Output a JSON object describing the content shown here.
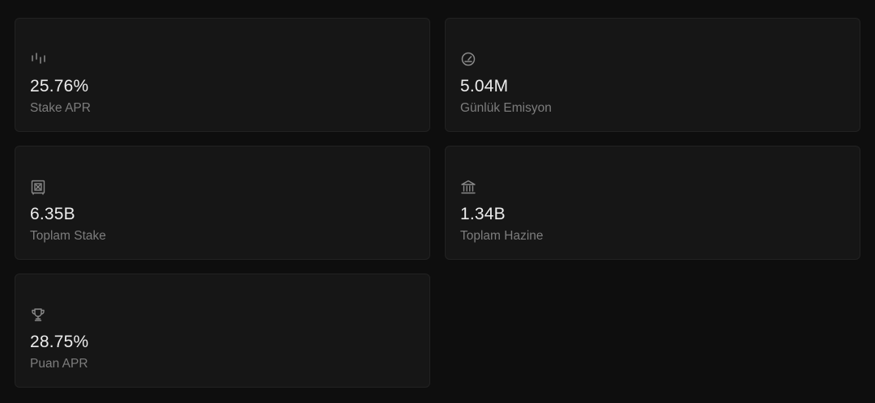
{
  "stats": [
    {
      "value": "25.76%",
      "label": "Stake APR",
      "icon": "bar-chart-icon"
    },
    {
      "value": "5.04M",
      "label": "Günlük Emisyon",
      "icon": "gauge-icon"
    },
    {
      "value": "6.35B",
      "label": "Toplam Stake",
      "icon": "vault-icon"
    },
    {
      "value": "1.34B",
      "label": "Toplam Hazine",
      "icon": "bank-icon"
    },
    {
      "value": "28.75%",
      "label": "Puan APR",
      "icon": "trophy-icon"
    }
  ],
  "colors": {
    "background": "#0e0e0e",
    "card": "#161616",
    "value": "#ececec",
    "label": "#7d7d7d",
    "icon": "#8a8a8a"
  }
}
